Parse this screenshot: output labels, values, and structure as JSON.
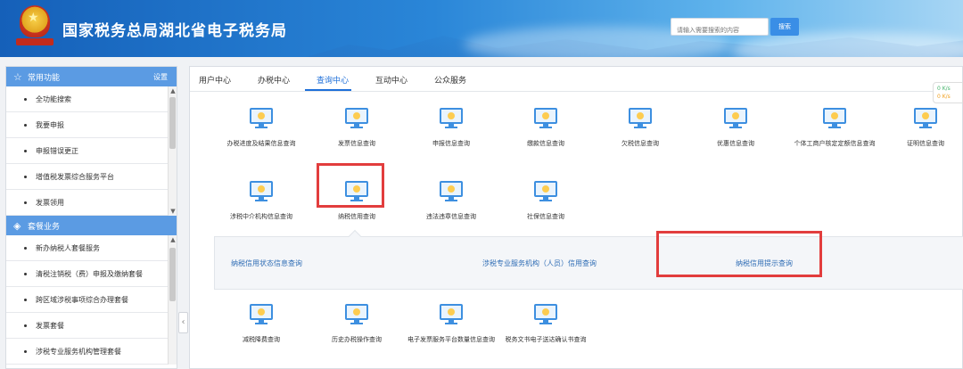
{
  "header": {
    "title": "国家税务总局湖北省电子税务局",
    "search_placeholder": "请输入需要搜索的内容",
    "search_button": "搜索"
  },
  "sidebar": {
    "common": {
      "title": "常用功能",
      "icon": "star-icon",
      "settings": "设置",
      "items": [
        {
          "label": "全功能搜索"
        },
        {
          "label": "我要申报"
        },
        {
          "label": "申报错误更正"
        },
        {
          "label": "增值税发票综合服务平台"
        },
        {
          "label": "发票领用"
        }
      ]
    },
    "packages": {
      "title": "套餐业务",
      "icon": "layers-icon",
      "items": [
        {
          "label": "新办纳税人套餐服务"
        },
        {
          "label": "清税注销税（费）申报及缴纳套餐"
        },
        {
          "label": "跨区域涉税事项综合办理套餐"
        },
        {
          "label": "发票套餐"
        },
        {
          "label": "涉税专业服务机构管理套餐"
        }
      ]
    }
  },
  "tabs": [
    {
      "label": "用户中心"
    },
    {
      "label": "办税中心"
    },
    {
      "label": "查询中心",
      "active": true
    },
    {
      "label": "互动中心"
    },
    {
      "label": "公众服务"
    }
  ],
  "tiles_row1": [
    {
      "label": "办税进度及结果信息查询",
      "icon": "monitor-icon"
    },
    {
      "label": "发票信息查询",
      "icon": "monitor-icon"
    },
    {
      "label": "申报信息查询",
      "icon": "monitor-icon"
    },
    {
      "label": "缴款信息查询",
      "icon": "monitor-icon"
    },
    {
      "label": "欠税信息查询",
      "icon": "monitor-icon"
    },
    {
      "label": "优惠信息查询",
      "icon": "monitor-icon"
    },
    {
      "label": "个体工商户核定定额信息查询",
      "icon": "monitor-icon"
    },
    {
      "label": "证明信息查询",
      "icon": "monitor-icon"
    }
  ],
  "tiles_row2": [
    {
      "label": "涉税中介机构信息查询",
      "icon": "monitor-icon"
    },
    {
      "label": "纳税信用查询",
      "icon": "monitor-icon"
    },
    {
      "label": "违法违章信息查询",
      "icon": "monitor-icon"
    },
    {
      "label": "社保信息查询",
      "icon": "monitor-icon"
    }
  ],
  "subpanel_links": [
    {
      "label": "纳税信用状态信息查询"
    },
    {
      "label": "涉税专业服务机构（人员）信用查询"
    },
    {
      "label": "纳税信用提示查询"
    }
  ],
  "tiles_row3": [
    {
      "label": "减税降费查询",
      "icon": "monitor-icon"
    },
    {
      "label": "历史办税操作查询",
      "icon": "monitor-icon"
    },
    {
      "label": "电子发票服务平台数量信息查询",
      "icon": "monitor-icon"
    },
    {
      "label": "税务文书电子送达确认书查询",
      "icon": "monitor-icon"
    }
  ],
  "speed_widget": {
    "up": "0 K/s",
    "down": "0 K/s"
  },
  "colors": {
    "accent": "#1e6fd9",
    "highlight": "#e23d3d",
    "sidebar_header": "#5b9be3"
  }
}
